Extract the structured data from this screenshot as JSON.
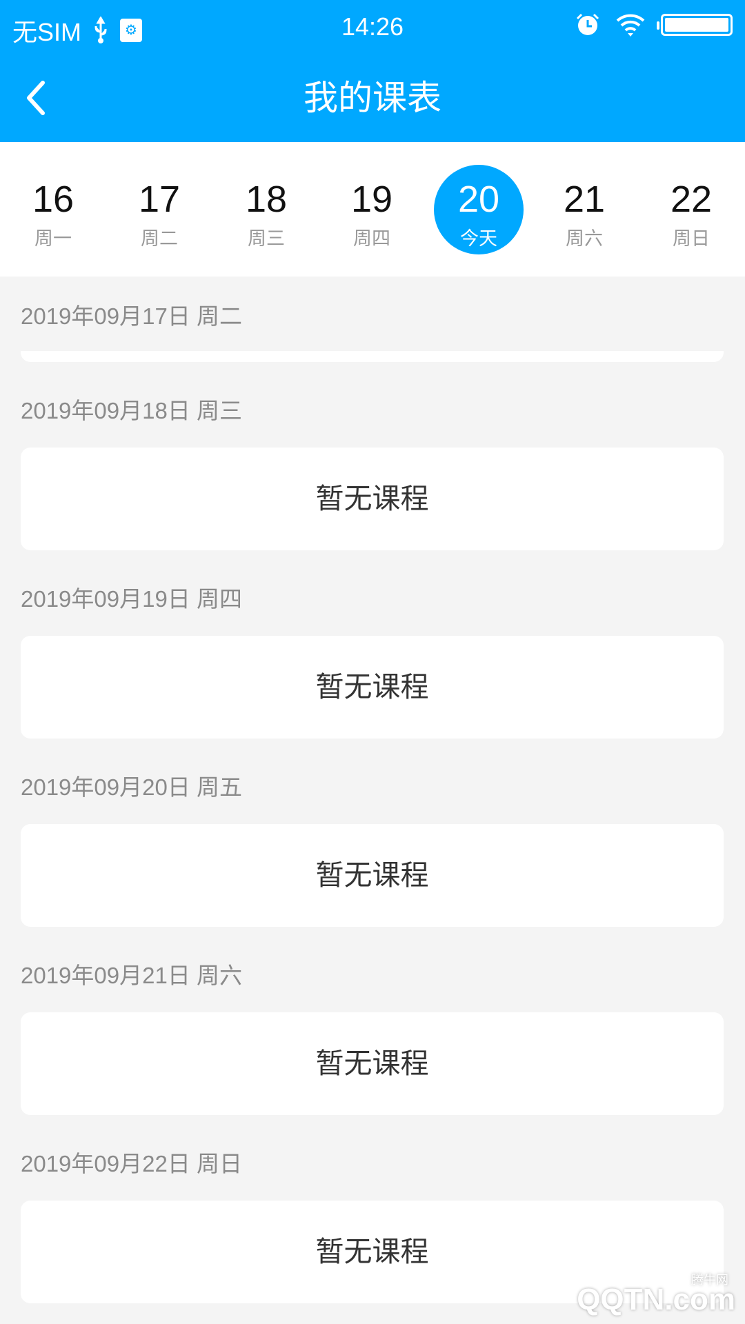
{
  "status_bar": {
    "carrier": "无SIM",
    "time": "14:26",
    "usb_debug_icon": "usb-icon"
  },
  "header": {
    "title": "我的课表",
    "back_icon": "chevron-left-icon"
  },
  "week_strip": [
    {
      "day": "16",
      "label": "周一",
      "active": false
    },
    {
      "day": "17",
      "label": "周二",
      "active": false
    },
    {
      "day": "18",
      "label": "周三",
      "active": false
    },
    {
      "day": "19",
      "label": "周四",
      "active": false
    },
    {
      "day": "20",
      "label": "今天",
      "active": true
    },
    {
      "day": "21",
      "label": "周六",
      "active": false
    },
    {
      "day": "22",
      "label": "周日",
      "active": false
    }
  ],
  "schedule": [
    {
      "date": "2019年09月17日 周二"
    },
    {
      "date": "2019年09月18日 周三",
      "content": "暂无课程"
    },
    {
      "date": "2019年09月19日 周四",
      "content": "暂无课程"
    },
    {
      "date": "2019年09月20日 周五",
      "content": "暂无课程"
    },
    {
      "date": "2019年09月21日 周六",
      "content": "暂无课程"
    },
    {
      "date": "2019年09月22日 周日",
      "content": "暂无课程"
    }
  ],
  "colors": {
    "accent": "#00a8ff",
    "background": "#f4f4f4"
  },
  "watermark": {
    "brand": "QQTN.com",
    "sub": "腾牛网"
  }
}
